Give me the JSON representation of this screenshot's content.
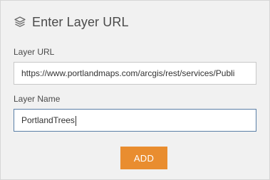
{
  "header": {
    "icon": "layers-icon",
    "title": "Enter Layer URL"
  },
  "fields": {
    "layer_url": {
      "label": "Layer URL",
      "value": "https://www.portlandmaps.com/arcgis/rest/services/Publi"
    },
    "layer_name": {
      "label": "Layer Name",
      "value": "PortlandTrees"
    }
  },
  "actions": {
    "add_label": "ADD"
  },
  "colors": {
    "panel_bg": "#f1f1f1",
    "accent": "#e98d2f",
    "focus_border": "#5a7ea6"
  }
}
